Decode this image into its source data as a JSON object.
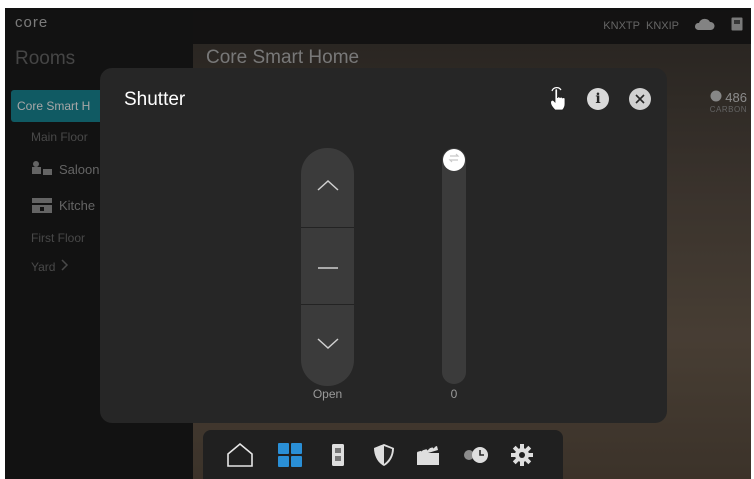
{
  "brand": {
    "logo_text": "core"
  },
  "top_status": {
    "knx_tp": "KNXTP",
    "knx_ip": "KNXIP",
    "icons": [
      "cloud-icon",
      "device-icon"
    ]
  },
  "sidebar": {
    "title": "Rooms",
    "items": [
      {
        "label": "Core Smart H",
        "active": true
      },
      {
        "label": "Main Floor",
        "type": "section"
      },
      {
        "label": "Saloon",
        "type": "room",
        "icon": "sofa-icon"
      },
      {
        "label": "Kitche",
        "type": "room",
        "icon": "kitchen-icon"
      },
      {
        "label": "First Floor",
        "type": "section"
      },
      {
        "label": "Yard",
        "type": "section",
        "icon": "chevron-right-icon"
      }
    ]
  },
  "main": {
    "title": "Core Smart Home"
  },
  "weather": {
    "value": "486",
    "unit": "CARBON"
  },
  "modal": {
    "title": "Shutter",
    "header_icons": [
      "touch-icon",
      "info-icon",
      "close-icon"
    ],
    "control": {
      "label": "Open",
      "buttons": [
        "up-icon",
        "stop-icon",
        "down-icon"
      ]
    },
    "slider": {
      "value": "0",
      "level": 0
    }
  },
  "bottom_nav": {
    "items": [
      "home-icon",
      "rooms-icon",
      "devices-icon",
      "security-icon",
      "scenes-icon",
      "schedule-icon",
      "settings-icon"
    ],
    "active": "rooms-icon"
  },
  "colors": {
    "accent": "#1a8a99",
    "modal_bg": "#262626",
    "control_bg": "#3b3b3b",
    "active_nav": "#2a8fd6"
  }
}
